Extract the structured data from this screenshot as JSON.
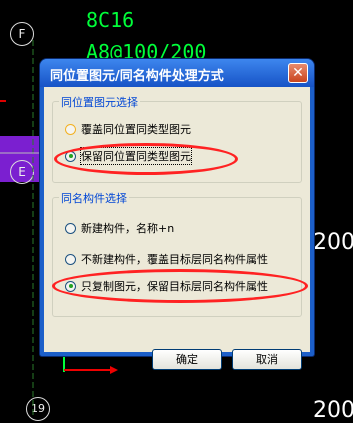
{
  "cad": {
    "top_text_1": "8C16",
    "top_text_2": "A8@100/200",
    "right_text_1": "200",
    "right_text_2": "200",
    "axis_f": "F",
    "axis_e": "E",
    "axis_19": "19"
  },
  "dialog": {
    "title": "同位置图元/同名构件处理方式",
    "close_glyph": "✕",
    "group1": {
      "legend": "同位置图元选择",
      "options": [
        {
          "label": "覆盖同位置同类型图元",
          "checked": false
        },
        {
          "label": "保留同位置同类型图元",
          "checked": true
        }
      ]
    },
    "group2": {
      "legend": "同名构件选择",
      "options": [
        {
          "label": "新建构件，名称+n",
          "checked": false
        },
        {
          "label": "不新建构件，覆盖目标层同名构件属性",
          "checked": false
        },
        {
          "label": "只复制图元，保留目标层同名构件属性",
          "checked": true
        }
      ]
    },
    "ok_label": "确定",
    "cancel_label": "取消"
  },
  "colors": {
    "title_bar": "#1c5fc9",
    "client_bg": "#ece9d8",
    "legend_text": "#0046d5",
    "annotation_oval": "#ff2222",
    "cad_text": "#00ff3a"
  }
}
